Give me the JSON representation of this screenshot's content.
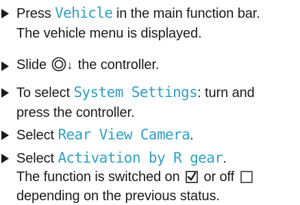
{
  "steps": [
    {
      "parts": {
        "pre": "Press ",
        "term": "Vehicle",
        "post": " in the main function bar."
      },
      "second_line": "The vehicle menu is displayed."
    },
    {
      "parts": {
        "pre": "Slide ",
        "icon": "controller-dial-icon",
        "arrow": "↓",
        "post": " the controller."
      }
    },
    {
      "parts": {
        "pre": "To select ",
        "term": "System Settings",
        "post": ": turn and"
      },
      "second_line": "press the controller."
    },
    {
      "parts": {
        "pre": "Select ",
        "term": "Rear View Camera",
        "post": "."
      }
    },
    {
      "parts": {
        "pre": "Select ",
        "term": "Activation by R gear",
        "post": "."
      },
      "second_line": {
        "pre": "The function is switched on ",
        "checked_icon": "checkbox-checked-icon",
        "mid": " or off ",
        "unchecked_icon": "checkbox-unchecked-icon"
      },
      "third_line": "depending on the previous status."
    }
  ],
  "colors": {
    "text": "#1a1a1a",
    "term": "#2fa0c4"
  }
}
